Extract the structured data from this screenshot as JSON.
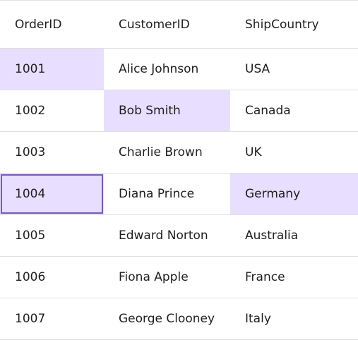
{
  "colors": {
    "selected_bg": "#e8deff",
    "active_border": "#7a5bb8",
    "grid_line": "#e0e0e0"
  },
  "columns": [
    "OrderID",
    "CustomerID",
    "ShipCountry"
  ],
  "rows": [
    {
      "order_id": "1001",
      "customer": "Alice Johnson",
      "country": "USA"
    },
    {
      "order_id": "1002",
      "customer": "Bob Smith",
      "country": "Canada"
    },
    {
      "order_id": "1003",
      "customer": "Charlie Brown",
      "country": "UK"
    },
    {
      "order_id": "1004",
      "customer": "Diana Prince",
      "country": "Germany"
    },
    {
      "order_id": "1005",
      "customer": "Edward Norton",
      "country": "Australia"
    },
    {
      "order_id": "1006",
      "customer": "Fiona Apple",
      "country": "France"
    },
    {
      "order_id": "1007",
      "customer": "George Clooney",
      "country": "Italy"
    }
  ],
  "selected_cells": [
    {
      "row": 0,
      "col": 0
    },
    {
      "row": 1,
      "col": 1
    },
    {
      "row": 3,
      "col": 0
    },
    {
      "row": 3,
      "col": 2
    }
  ],
  "active_cell": {
    "row": 3,
    "col": 0
  }
}
